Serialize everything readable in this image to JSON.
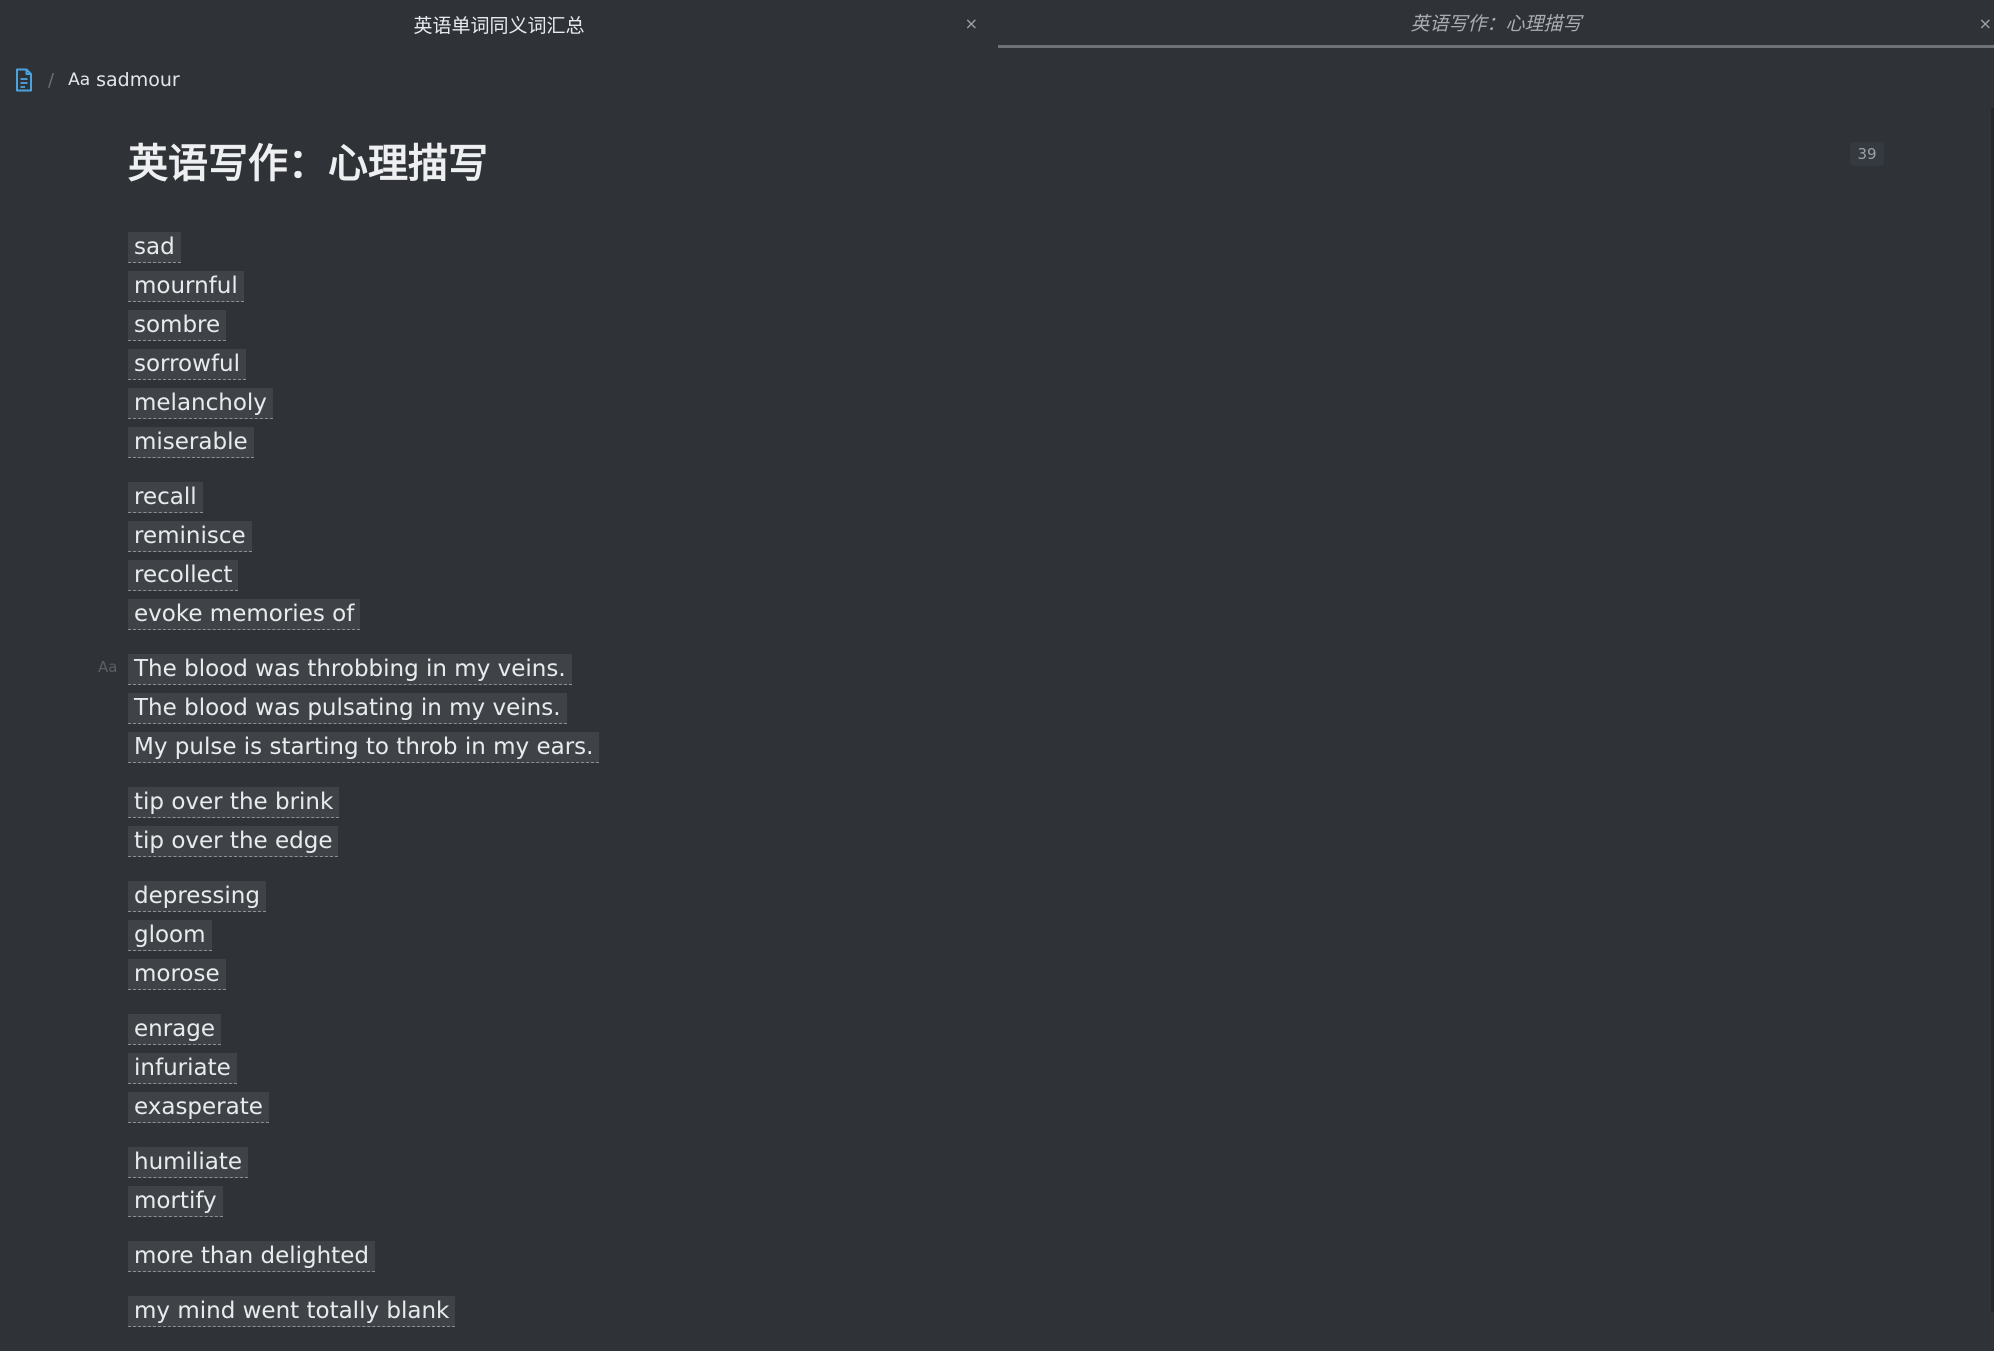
{
  "tabs": [
    {
      "title": "英语单词同义词汇总",
      "close": "×"
    },
    {
      "title": "英语写作：心理描写",
      "close": "×"
    }
  ],
  "breadcrumb": {
    "separator": "/",
    "prefix": "Aa",
    "item": "sadmour"
  },
  "page": {
    "title": "英语写作：心理描写",
    "count": "39",
    "line_hint": "Aa"
  },
  "groups": [
    [
      "sad",
      "mournful",
      "sombre",
      "sorrowful",
      "melancholy",
      "miserable"
    ],
    [
      "recall",
      "reminisce",
      "recollect",
      "evoke memories of"
    ],
    [
      "The blood was throbbing in my veins.",
      "The blood was pulsating in my veins.",
      "My pulse is starting to throb in my ears. "
    ],
    [
      "tip over the brink",
      "tip over the edge"
    ],
    [
      "depressing",
      "gloom",
      "morose"
    ],
    [
      "enrage",
      "infuriate",
      "exasperate"
    ],
    [
      "humiliate",
      "mortify"
    ],
    [
      "more than delighted"
    ],
    [
      "my mind went totally blank"
    ]
  ],
  "colors": {
    "background": "#2f3337",
    "chip": "#3f4347",
    "accent_icon": "#4aa3df"
  },
  "icons": {
    "breadcrumb": "document-icon"
  }
}
